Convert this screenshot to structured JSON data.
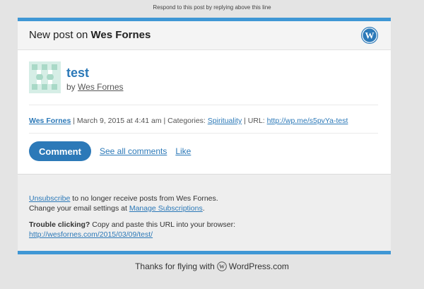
{
  "email": {
    "top_note": "Respond to this post by replying above this line",
    "header": {
      "prefix": "New post on ",
      "site_name": "Wes Fornes",
      "logo_icon": "wordpress-logo-icon"
    },
    "post": {
      "title": "test",
      "by_label": "by",
      "author": "Wes Fornes"
    },
    "meta": {
      "author": "Wes Fornes",
      "date_text": "March 9, 2015 at 4:41 am",
      "categories_label": "Categories:",
      "category": "Spirituality",
      "url_label": "URL:",
      "url": "http://wp.me/s5pvYa-test",
      "separator": "|"
    },
    "actions": {
      "comment_label": "Comment",
      "see_all_comments_label": "See all comments",
      "like_label": "Like"
    },
    "footer": {
      "unsubscribe_link": "Unsubscribe",
      "unsubscribe_text": " to no longer receive posts from Wes Fornes.",
      "change_settings_text": "Change your email settings at ",
      "manage_subscriptions_link": "Manage Subscriptions",
      "trouble_label": "Trouble clicking?",
      "trouble_text": " Copy and paste this URL into your browser:",
      "post_url": "http://wesfornes.com/2015/03/09/test/"
    },
    "bottom": {
      "thanks_prefix": "Thanks for flying with",
      "brand": "WordPress.com"
    },
    "colors": {
      "accent": "#3f97d5",
      "link": "#2c79b8",
      "background": "#e4e4e4"
    }
  }
}
